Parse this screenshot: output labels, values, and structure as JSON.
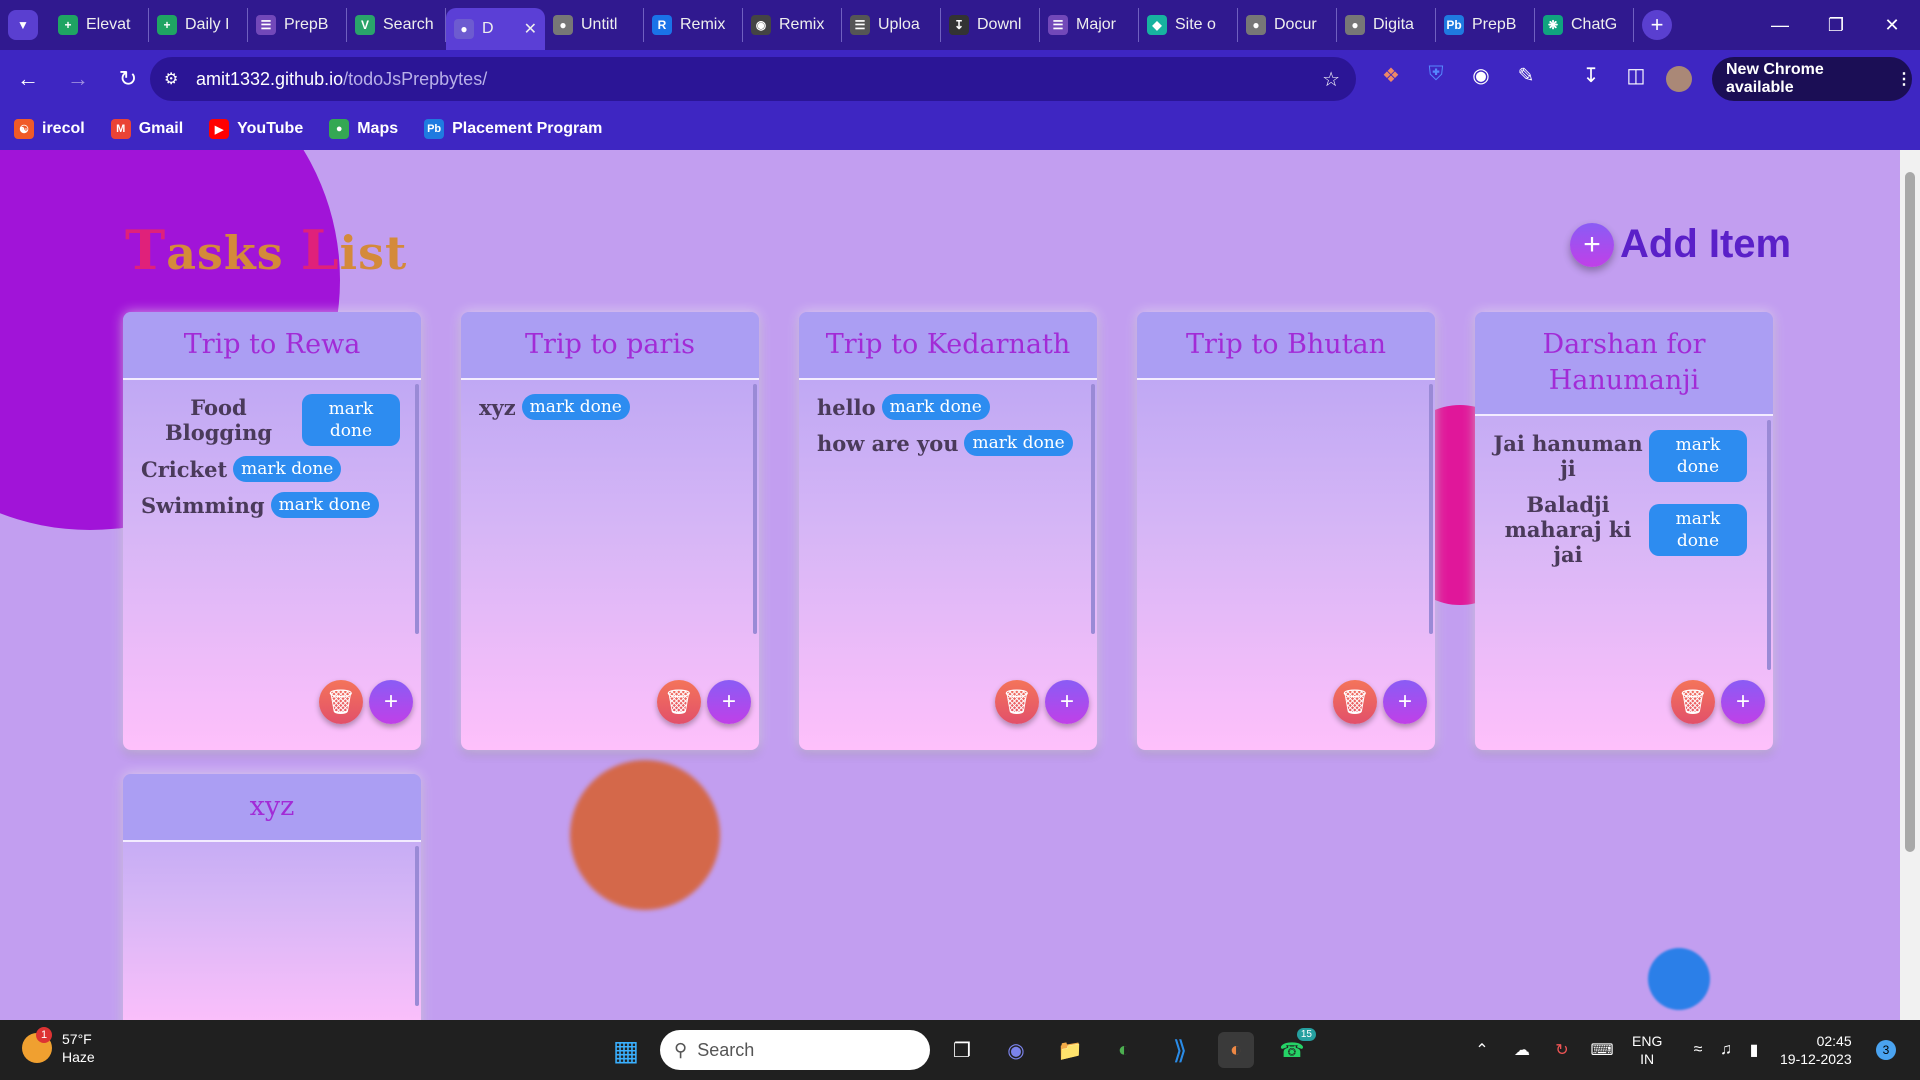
{
  "browser": {
    "tabs": [
      {
        "title": "Elevat",
        "icon": "sheets-icon",
        "color": "#1fa463",
        "active": false
      },
      {
        "title": "Daily I",
        "icon": "sheets-icon",
        "color": "#1fa463",
        "active": false
      },
      {
        "title": "PrepB",
        "icon": "forms-icon",
        "color": "#7248b9",
        "active": false
      },
      {
        "title": "Search",
        "icon": "vercel-icon",
        "color": "#2aa36b",
        "active": false
      },
      {
        "title": "D",
        "icon": "globe-icon",
        "color": "#6d5bd0",
        "active": true
      },
      {
        "title": "Untitl",
        "icon": "globe-icon",
        "color": "#777",
        "active": false
      },
      {
        "title": "Remix",
        "icon": "remix-icon",
        "color": "#1a73e8",
        "active": false
      },
      {
        "title": "Remix",
        "icon": "github-icon",
        "color": "#444",
        "active": false
      },
      {
        "title": "Uploa",
        "icon": "layers-icon",
        "color": "#555",
        "active": false
      },
      {
        "title": "Downl",
        "icon": "download-icon",
        "color": "#333",
        "active": false
      },
      {
        "title": "Major",
        "icon": "forms-icon",
        "color": "#7248b9",
        "active": false
      },
      {
        "title": "Site o",
        "icon": "diamond-icon",
        "color": "#17b2a0",
        "active": false
      },
      {
        "title": "Docur",
        "icon": "globe-icon",
        "color": "#777",
        "active": false
      },
      {
        "title": "Digita",
        "icon": "globe-icon",
        "color": "#777",
        "active": false
      },
      {
        "title": "PrepB",
        "icon": "prepbytes-icon",
        "color": "#1f7ae0",
        "active": false
      },
      {
        "title": "ChatG",
        "icon": "chatgpt-icon",
        "color": "#10a37f",
        "active": false
      }
    ],
    "url_host": "amit1332.github.io",
    "url_path": "/todoJsPrepbytes/",
    "new_chrome": "New Chrome available",
    "bookmarks": [
      {
        "label": "irecol",
        "icon": "irecol-icon",
        "color": "#f05a28"
      },
      {
        "label": "Gmail",
        "icon": "gmail-icon",
        "color": "#ea4335"
      },
      {
        "label": "YouTube",
        "icon": "youtube-icon",
        "color": "#ff0000"
      },
      {
        "label": "Maps",
        "icon": "maps-icon",
        "color": "#34a853"
      },
      {
        "label": "Placement Program",
        "icon": "prepbytes-icon",
        "color": "#1f7ae0"
      }
    ]
  },
  "page": {
    "title_first_cap": "T",
    "title_first_rest": "asks ",
    "title_second_cap": "L",
    "title_second_rest": "ist",
    "add_item_label": "Add Item",
    "cards": [
      {
        "title": "Trip to Rewa",
        "items": [
          {
            "text": "Food Blogging",
            "btn": "mark done"
          },
          {
            "text": "Cricket",
            "btn": "mark done"
          },
          {
            "text": "Swimming",
            "btn": "mark done"
          }
        ]
      },
      {
        "title": "Trip to paris",
        "items": [
          {
            "text": "xyz",
            "btn": "mark done"
          }
        ]
      },
      {
        "title": "Trip to Kedarnath",
        "items": [
          {
            "text": "hello",
            "btn": "mark done"
          },
          {
            "text": "how are you",
            "btn": "mark done"
          }
        ]
      },
      {
        "title": "Trip to Bhutan",
        "items": []
      },
      {
        "title": "Darshan for Hanumanji",
        "items": [
          {
            "text": "Jai hanuman ji",
            "btn": "mark done"
          },
          {
            "text": "Baladji maharaj ki jai",
            "btn": "mark done"
          }
        ]
      },
      {
        "title": "xyz",
        "items": []
      }
    ]
  },
  "taskbar": {
    "weather_temp": "57°F",
    "weather_desc": "Haze",
    "weather_badge": "1",
    "search_placeholder": "Search",
    "whatsapp_badge": "15",
    "lang_top": "ENG",
    "lang_bottom": "IN",
    "time": "02:45",
    "date": "19-12-2023",
    "notif_count": "3"
  }
}
